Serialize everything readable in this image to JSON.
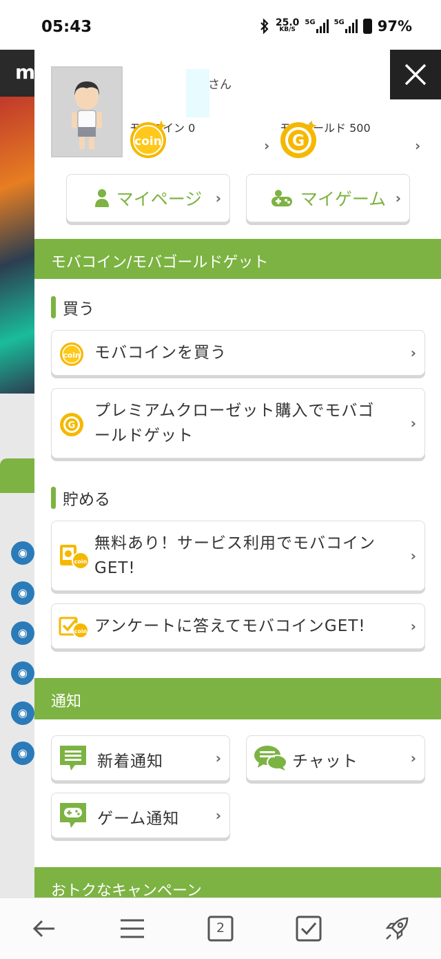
{
  "status_bar": {
    "time": "05:43",
    "net_speed": "25.0",
    "net_unit": "KB/S",
    "sim1": "5G",
    "sim2": "5G",
    "battery": "97%"
  },
  "background_page": {
    "logo_letter": "m"
  },
  "drawer": {
    "user": {
      "name_suffix": "さん"
    },
    "mobacoin": {
      "label": "モバコイン",
      "value": "0",
      "icon_text": "coin"
    },
    "mobagold": {
      "label": "モバゴールド",
      "value": "500",
      "icon_text": "G"
    },
    "buttons": {
      "mypage": "マイページ",
      "mygame": "マイゲーム"
    },
    "section_get": {
      "title": "モバコイン/モバゴールドゲット",
      "buy_label": "買う",
      "buy_items": [
        {
          "text": "モバコインを買う"
        },
        {
          "text_line1": "プレミアムクローゼット購入でモバゴ",
          "text_line2": "ールドゲット"
        }
      ],
      "save_label": "貯める",
      "save_items": [
        {
          "text_line1": "無料あり！サービス利用でモバコイン",
          "text_line2": "GET!"
        },
        {
          "text": "アンケートに答えてモバコインGET!"
        }
      ]
    },
    "section_notify": {
      "title": "通知",
      "items": [
        "新着通知",
        "チャット",
        "ゲーム通知"
      ]
    },
    "section_campaign": {
      "title": "おトクなキャンペーン"
    }
  },
  "bottom_nav": {
    "tabs_count": "2"
  },
  "colors": {
    "accent_green": "#7cb342",
    "coin_yellow": "#f5b800",
    "close_bg": "#222222"
  }
}
